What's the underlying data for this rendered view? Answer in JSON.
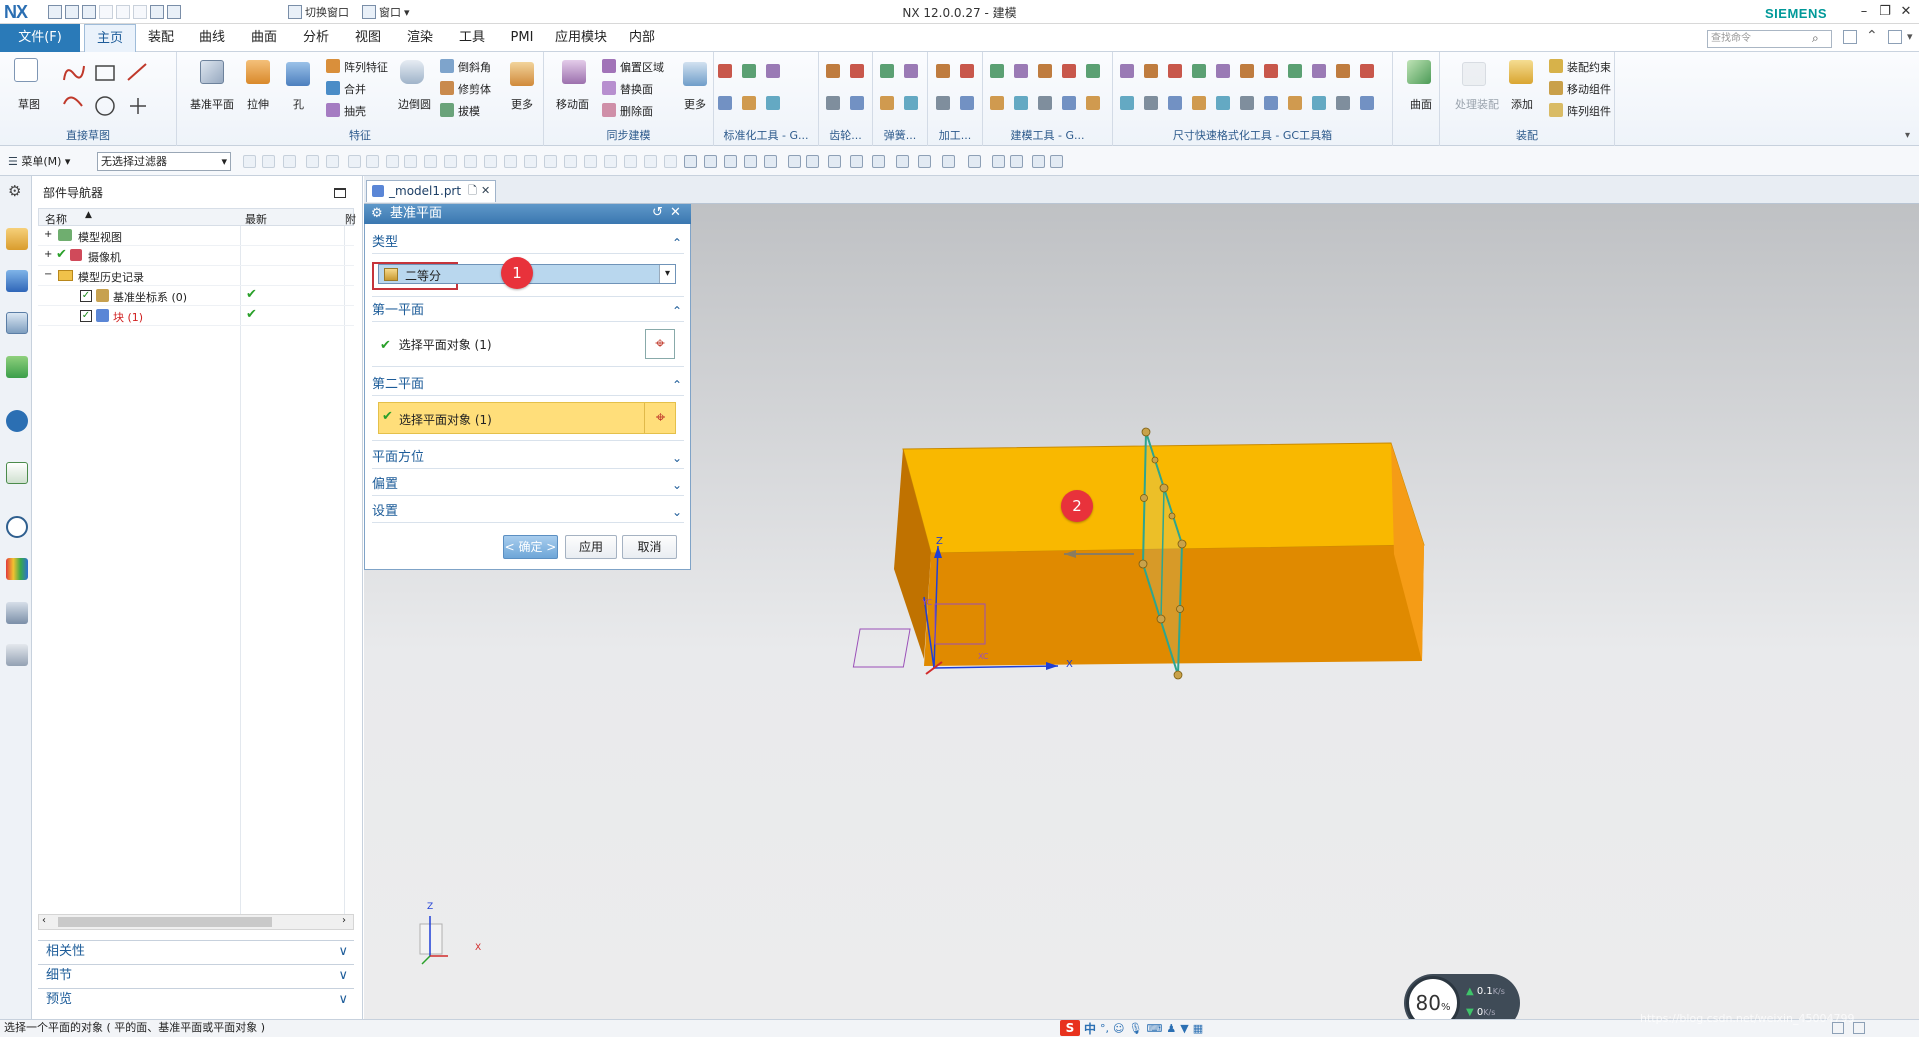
{
  "window": {
    "app_logo": "NX",
    "title": "NX 12.0.0.27 - 建模",
    "brand": "SIEMENS",
    "quick_access": {
      "switch_window": "切换窗口",
      "window": "窗口"
    },
    "controls": [
      "–",
      "❐",
      "✕"
    ]
  },
  "menu": {
    "file": "文件(F)",
    "tabs": [
      "主页",
      "装配",
      "曲线",
      "曲面",
      "分析",
      "视图",
      "渲染",
      "工具",
      "PMI",
      "应用模块",
      "内部"
    ],
    "active_tab": "主页",
    "search_placeholder": "查找命令"
  },
  "ribbon": {
    "groups": [
      {
        "label": "直接草图",
        "items": [
          "草图"
        ]
      },
      {
        "label": "特征",
        "items": [
          "基准平面",
          "拉伸",
          "孔",
          "阵列特征",
          "合并",
          "抽壳",
          "边倒圆",
          "倒斜角",
          "修剪体",
          "拔模",
          "更多"
        ]
      },
      {
        "label": "同步建模",
        "items": [
          "移动面",
          "偏置区域",
          "替换面",
          "删除面",
          "更多"
        ]
      },
      {
        "label": "标准化工具 - G...",
        "items": []
      },
      {
        "label": "齿轮...",
        "items": []
      },
      {
        "label": "弹簧...",
        "items": []
      },
      {
        "label": "加工...",
        "items": []
      },
      {
        "label": "建模工具 - G...",
        "items": []
      },
      {
        "label": "尺寸快速格式化工具 - GC工具箱",
        "items": []
      },
      {
        "label": "",
        "items": [
          "曲面"
        ]
      },
      {
        "label": "装配",
        "items": [
          "处理装配",
          "添加",
          "装配约束",
          "移动组件",
          "阵列组件"
        ]
      }
    ]
  },
  "toolbar2": {
    "menu_label": "菜单(M)",
    "filter": "无选择过滤器"
  },
  "navigator": {
    "title": "部件导航器",
    "columns": [
      "名称",
      "最新",
      "附"
    ],
    "rows": [
      {
        "label": "模型视图",
        "latest": ""
      },
      {
        "label": "摄像机",
        "latest": ""
      },
      {
        "label": "模型历史记录",
        "latest": ""
      },
      {
        "label": "基准坐标系 (0)",
        "latest": "✔"
      },
      {
        "label": "块 (1)",
        "latest": "✔"
      }
    ],
    "sections": [
      "相关性",
      "细节",
      "预览"
    ]
  },
  "document": {
    "tab": "_model1.prt"
  },
  "dialog": {
    "title": "基准平面",
    "type_section": "类型",
    "type_value": "二等分",
    "first_plane_section": "第一平面",
    "first_plane_select": "选择平面对象 (1)",
    "second_plane_section": "第二平面",
    "second_plane_select": "选择平面对象 (1)",
    "collapsed": [
      "平面方位",
      "偏置",
      "设置"
    ],
    "buttons": {
      "ok": "< 确定 >",
      "apply": "应用",
      "cancel": "取消"
    }
  },
  "annotations": {
    "marker1": "1",
    "marker2": "2"
  },
  "axes": {
    "x": "X",
    "y": "Y",
    "z": "Z",
    "xc": "XC",
    "yc": "YC"
  },
  "status": {
    "prompt": "选择一个平面的对象 ( 平的面、基准平面或平面对象 )",
    "cpu_percent": "80",
    "cpu_unit": "%",
    "net_up": "0.1",
    "net_up_unit": "K/s",
    "net_down": "0",
    "net_down_unit": "K/s",
    "ime": "中",
    "watermark": "https://blog.csdn.net/weixin_45004799"
  },
  "colors": {
    "accent": "#2a7ab8",
    "block_top": "#f9b800",
    "block_side": "#e08a00",
    "highlight": "#ffde7a",
    "marker": "#e8323b",
    "plane": "#2ea58f"
  }
}
